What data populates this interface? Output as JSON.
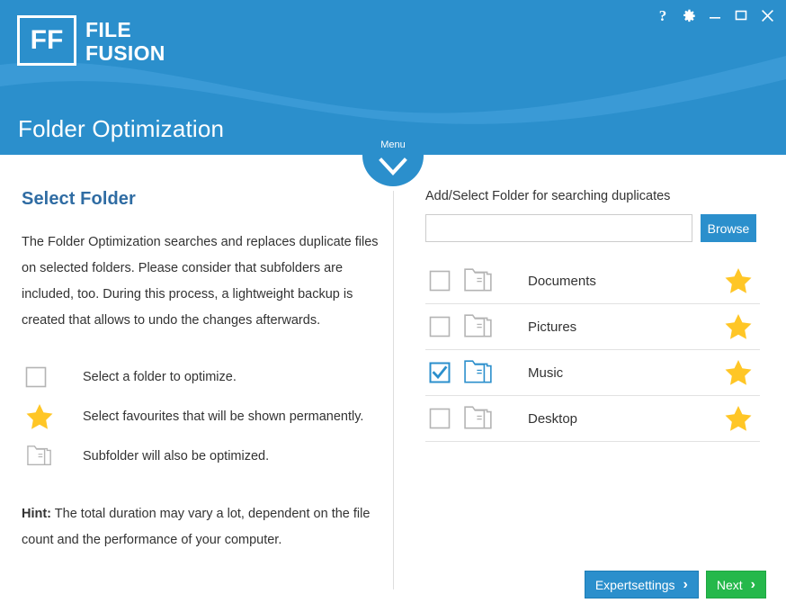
{
  "window": {
    "controls": [
      {
        "name": "help-icon",
        "glyph": "?"
      },
      {
        "name": "settings-gear-icon",
        "glyph": "gear"
      },
      {
        "name": "minimize-icon",
        "glyph": "minimize"
      },
      {
        "name": "maximize-icon",
        "glyph": "maximize"
      },
      {
        "name": "close-icon",
        "glyph": "close"
      }
    ]
  },
  "header": {
    "logo_mark": "FF",
    "logo_line1": "FILE",
    "logo_line2": "FUSION",
    "page_title": "Folder Optimization",
    "background_color": "#2B8FCC"
  },
  "menu_tab": {
    "label": "Menu",
    "icon": "chevron-down-icon"
  },
  "left_panel": {
    "heading": "Select Folder",
    "description": "The Folder Optimization searches and replaces duplicate files on selected folders. Please consider that subfolders are included, too. During this process, a lightweight backup is created that allows to undo the changes afterwards.",
    "legend": [
      {
        "icon": "checkbox-icon",
        "text": "Select a folder to optimize."
      },
      {
        "icon": "star-icon",
        "text": "Select favourites that will be shown permanently."
      },
      {
        "icon": "folder-icon",
        "text": "Subfolder will also be optimized."
      }
    ],
    "hint_label": "Hint:",
    "hint_text": " The total duration may vary a lot, dependent on the file count and the performance of your computer."
  },
  "right_panel": {
    "label": "Add/Select Folder for searching duplicates",
    "input_value": "",
    "input_placeholder": "",
    "browse_label": "Browse",
    "folders": [
      {
        "name": "Documents",
        "checked": false,
        "favourite": true
      },
      {
        "name": "Pictures",
        "checked": false,
        "favourite": true
      },
      {
        "name": "Music",
        "checked": true,
        "favourite": true
      },
      {
        "name": "Desktop",
        "checked": false,
        "favourite": true
      }
    ]
  },
  "footer": {
    "expert_label": "Expertsettings",
    "expert_arrow": "›",
    "next_label": "Next",
    "next_arrow": "›"
  },
  "colors": {
    "brand_blue": "#2B8FCC",
    "heading_blue": "#2F6CA3",
    "next_green": "#25B84B",
    "star_yellow": "#FFC626",
    "icon_grey": "#B0B0B0"
  }
}
